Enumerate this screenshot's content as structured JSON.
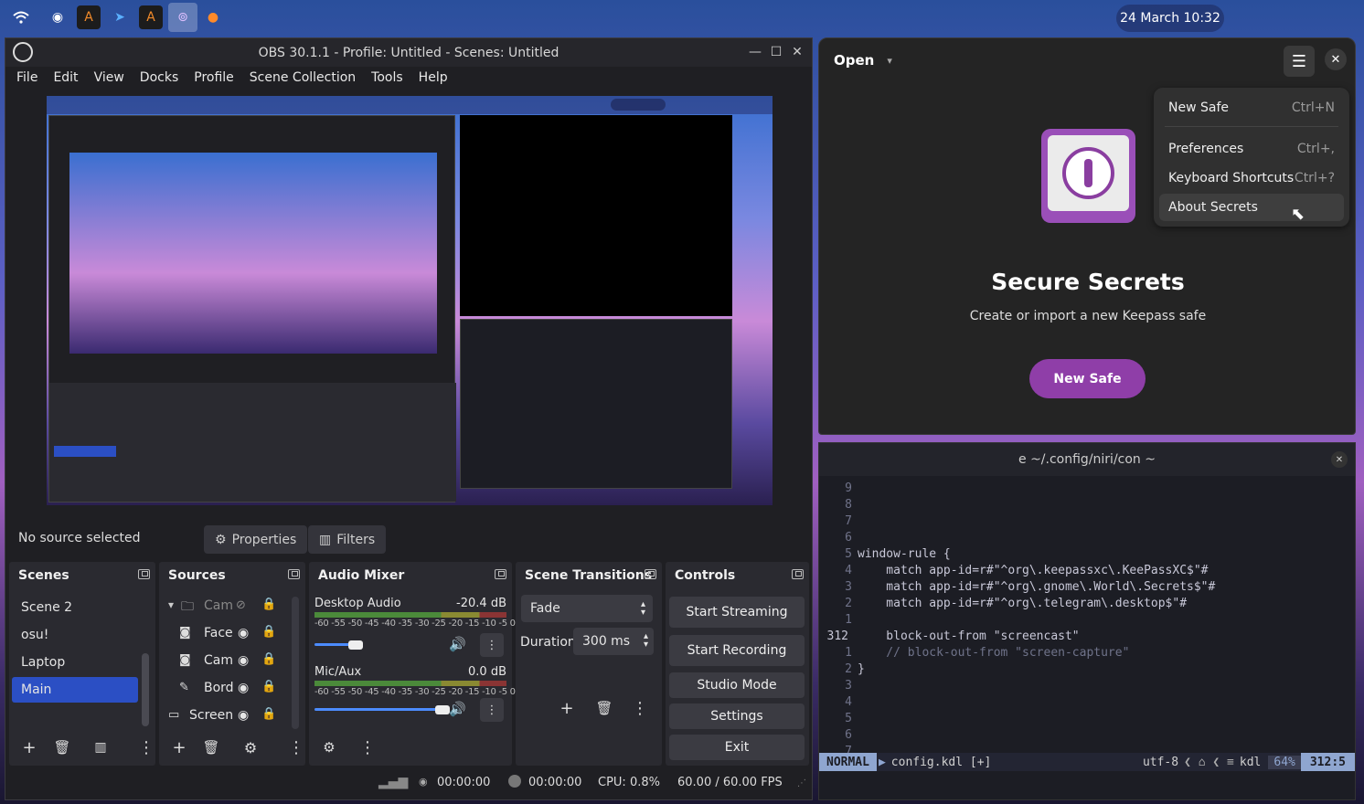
{
  "topbar": {
    "clock": "24 March 10:32",
    "icons": [
      "wifi-icon",
      "steam-icon",
      "arch-icon",
      "telegram-icon",
      "arch-icon",
      "secrets-icon",
      "firefox-icon"
    ]
  },
  "obs": {
    "title": "OBS 30.1.1 - Profile: Untitled - Scenes: Untitled",
    "menu": [
      "File",
      "Edit",
      "View",
      "Docks",
      "Profile",
      "Scene Collection",
      "Tools",
      "Help"
    ],
    "no_source": "No source selected",
    "properties": "Properties",
    "filters": "Filters",
    "scenes": {
      "title": "Scenes",
      "items": [
        "Scene 2",
        "osu!",
        "Laptop",
        "Main"
      ],
      "selected": "Main"
    },
    "sources": {
      "title": "Sources",
      "items": [
        "Cam",
        "Face",
        "Cam",
        "Bord",
        "Screen"
      ]
    },
    "mixer": {
      "title": "Audio Mixer",
      "channels": [
        {
          "name": "Desktop Audio",
          "db": "-20.4 dB",
          "level": 0.32
        },
        {
          "name": "Mic/Aux",
          "db": "0.0 dB",
          "level": 1.0
        }
      ],
      "scale": "-60 -55 -50 -45 -40 -35 -30 -25 -20 -15 -10 -5 0"
    },
    "transitions": {
      "title": "Scene Transitions",
      "type": "Fade",
      "duration_label": "Duration",
      "duration": "300 ms"
    },
    "controls": {
      "title": "Controls",
      "buttons": [
        "Start Streaming",
        "Start Recording",
        "Studio Mode",
        "Settings",
        "Exit"
      ]
    },
    "status": {
      "time1": "00:00:00",
      "time2": "00:00:00",
      "cpu": "CPU: 0.8%",
      "fps": "60.00 / 60.00 FPS"
    }
  },
  "secrets": {
    "open": "Open",
    "menu": [
      {
        "label": "New Safe",
        "accel": "Ctrl+N"
      },
      {
        "label": "Preferences",
        "accel": "Ctrl+,"
      },
      {
        "label": "Keyboard Shortcuts",
        "accel": "Ctrl+?"
      },
      {
        "label": "About Secrets",
        "accel": ""
      }
    ],
    "headline": "Secure Secrets",
    "subline": "Create or import a new Keepass safe",
    "new_safe": "New Safe",
    "accent": "#8f3ea8"
  },
  "terminal": {
    "title": "e ~/.config/niri/con ~",
    "lines": [
      {
        "n": "9",
        "t": ""
      },
      {
        "n": "8",
        "t": ""
      },
      {
        "n": "7",
        "t": ""
      },
      {
        "n": "6",
        "t": ""
      },
      {
        "n": "5",
        "t": "window-rule {"
      },
      {
        "n": "4",
        "t": "    match app-id=r#\"^org\\.keepassxc\\.KeePassXC$\"#"
      },
      {
        "n": "3",
        "t": "    match app-id=r#\"^org\\.gnome\\.World\\.Secrets$\"#"
      },
      {
        "n": "2",
        "t": "    match app-id=r#\"^org\\.telegram\\.desktop$\"#"
      },
      {
        "n": "1",
        "t": ""
      },
      {
        "n": "312",
        "t": "    block-out-from \"screencast\""
      },
      {
        "n": "1",
        "t": "    // block-out-from \"screen-capture\""
      },
      {
        "n": "2",
        "t": "}"
      },
      {
        "n": "3",
        "t": ""
      },
      {
        "n": "4",
        "t": ""
      },
      {
        "n": "5",
        "t": ""
      },
      {
        "n": "6",
        "t": ""
      },
      {
        "n": "7",
        "t": ""
      }
    ],
    "mode": "NORMAL",
    "file": "config.kdl [+]",
    "enc": "utf-8",
    "ft": "kdl",
    "pct": "64%",
    "pos": "312:5"
  }
}
